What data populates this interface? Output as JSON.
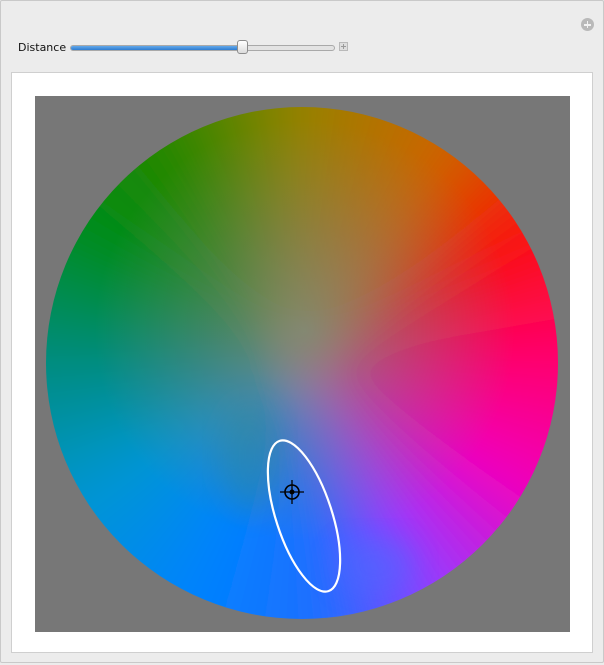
{
  "controls": {
    "distance_label": "Distance",
    "distance_value": 0.66
  },
  "icons": {
    "panel_plus": "plus-circle-icon",
    "slider_plus": "plus-square-icon",
    "marker": "crosshair-icon"
  },
  "colors": {
    "background": "#777777",
    "wheel_red": "#ff0000",
    "wheel_magenta": "#ff00a0",
    "wheel_blue": "#0078ff",
    "wheel_green": "#008c00",
    "ellipse": "#ffffff"
  }
}
